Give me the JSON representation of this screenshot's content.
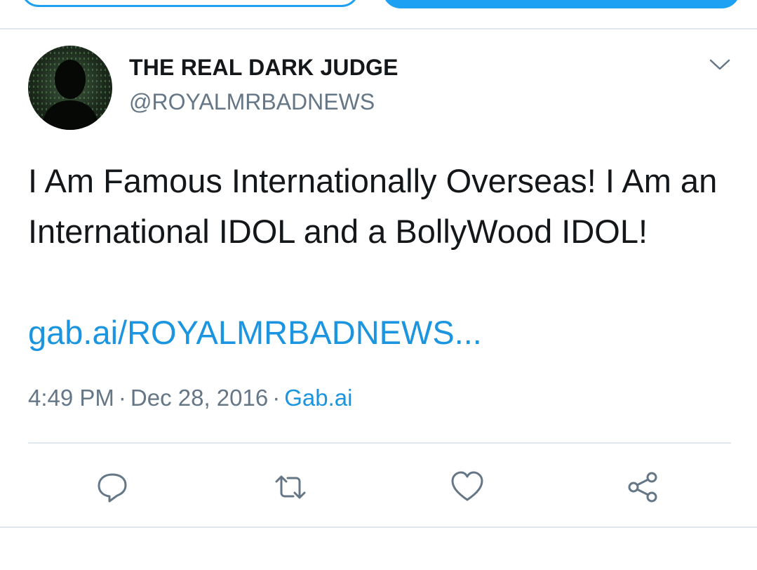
{
  "tweet": {
    "author": {
      "display_name": "THE REAL DARK JUDGE",
      "handle": "@ROYALMRBADNEWS"
    },
    "text": "I Am Famous Internationally Overseas! I Am an International IDOL and a BollyWood IDOL!",
    "link": "gab.ai/ROYALMRBADNEWS...",
    "time": "4:49 PM",
    "date": "Dec 28, 2016",
    "separator": "·",
    "source": "Gab.ai"
  },
  "actions": [
    {
      "icon": "reply-icon"
    },
    {
      "icon": "retweet-icon"
    },
    {
      "icon": "like-icon"
    },
    {
      "icon": "share-icon"
    }
  ],
  "colors": {
    "accent": "#1da1f2",
    "link": "#1b95e0",
    "secondary_text": "#657786",
    "primary_text": "#14171a",
    "divider": "#e1e8ed"
  }
}
